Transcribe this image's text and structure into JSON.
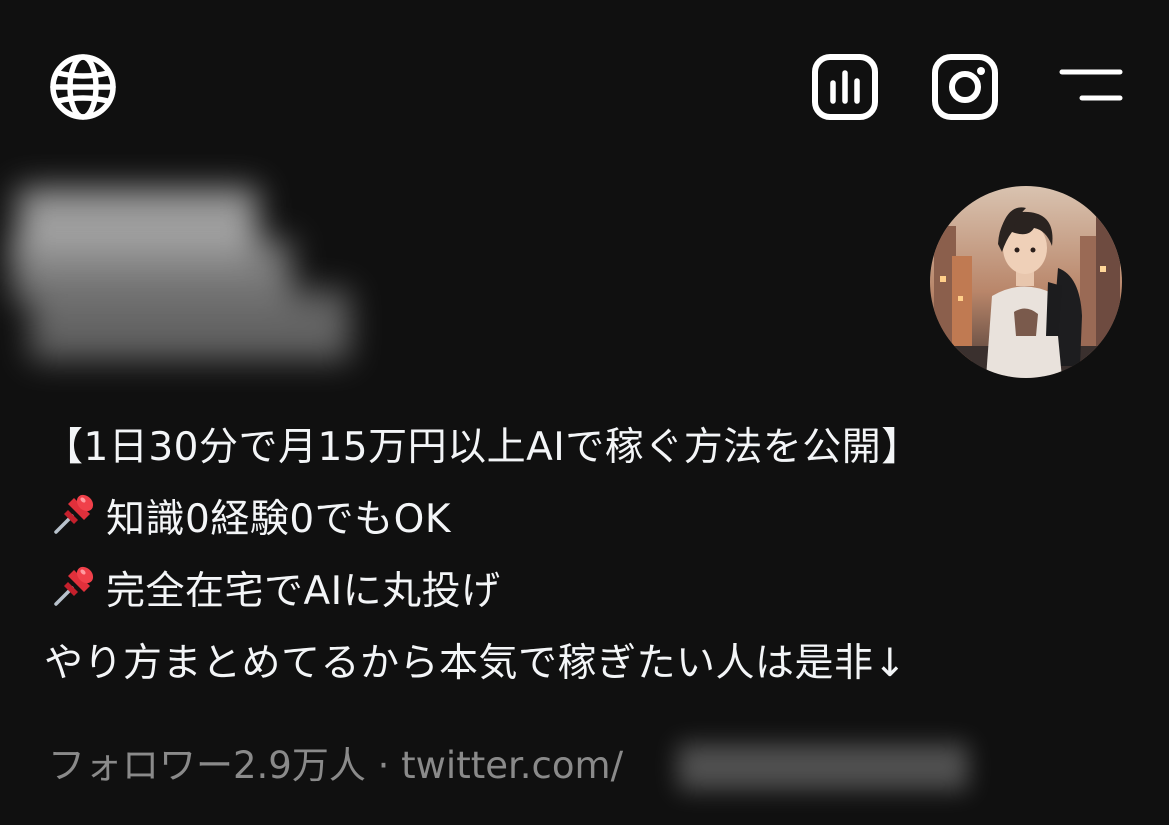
{
  "header": {
    "icons": [
      "globe-icon",
      "insights-icon",
      "instagram-icon",
      "menu-icon"
    ]
  },
  "profile": {
    "bio": {
      "line1": "【1日30分で月15万円以上AIで稼ぐ方法を公開】",
      "line2": "知識0経験0でもOK",
      "line3": "完全在宅でAIに丸投げ",
      "line4": "やり方まとめてるから本気で稼ぎたい人は是非↓"
    },
    "followers": "フォロワー2.9万人",
    "separator": " · ",
    "link": "twitter.com/"
  },
  "colors": {
    "background": "#101010",
    "text": "#f3f5f7",
    "muted": "#8a8a8a",
    "pin_red": "#e0303b"
  }
}
